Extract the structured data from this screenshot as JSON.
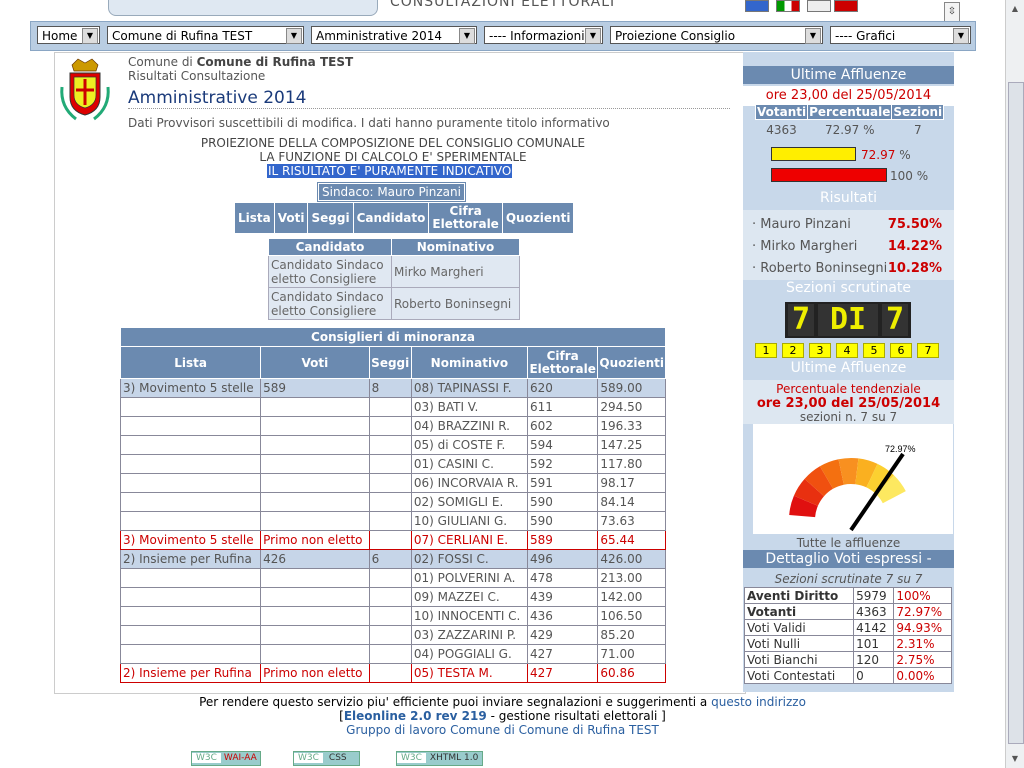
{
  "banner": {
    "title": "CONSULTAZIONI ELETTORALI"
  },
  "nav": {
    "selects": [
      "Home",
      "Comune di Rufina TEST",
      "Amministrative 2014",
      "---- Informazioni",
      "Proiezione Consiglio",
      "---- Grafici"
    ]
  },
  "header": {
    "comune_prefix": "Comune di",
    "comune_name": "Comune di Rufina TEST",
    "risultati": "Risultati Consultazione",
    "title": "Amministrative 2014",
    "notice": "Dati Provvisori suscettibili di modifica. I dati hanno puramente titolo informativo"
  },
  "projection": {
    "line1": "PROIEZIONE DELLA COMPOSIZIONE DEL CONSIGLIO COMUNALE",
    "line2": "LA FUNZIONE DI CALCOLO E' SPERIMENTALE",
    "line3": "IL RISULTATO E' PURAMENTE INDICATIVO",
    "sindaco": "Sindaco: Mauro Pinzani",
    "buttons": [
      "Lista",
      "Voti",
      "Seggi",
      "Candidato",
      "Cifra Elettorale",
      "Quozienti"
    ]
  },
  "candidates": {
    "headers": [
      "Candidato",
      "Nominativo"
    ],
    "rows": [
      {
        "role": "Candidato Sindaco eletto Consigliere",
        "name": "Mirko Margheri"
      },
      {
        "role": "Candidato Sindaco eletto Consigliere",
        "name": "Roberto Boninsegni"
      }
    ]
  },
  "minority": {
    "title": "Consiglieri di minoranza",
    "headers": [
      "Lista",
      "Voti",
      "Seggi",
      "Nominativo",
      "Cifra Elettorale",
      "Quozienti"
    ],
    "rows": [
      {
        "lista": "3) Movimento 5 stelle",
        "voti": "589",
        "seggi": "8",
        "nome": "08) TAPINASSI F.",
        "cifra": "620",
        "quoz": "589.00",
        "style": "hl-row"
      },
      {
        "lista": "",
        "voti": "",
        "seggi": "",
        "nome": "03) BATI V.",
        "cifra": "611",
        "quoz": "294.50",
        "style": ""
      },
      {
        "lista": "",
        "voti": "",
        "seggi": "",
        "nome": "04) BRAZZINI R.",
        "cifra": "602",
        "quoz": "196.33",
        "style": ""
      },
      {
        "lista": "",
        "voti": "",
        "seggi": "",
        "nome": "05) di COSTE F.",
        "cifra": "594",
        "quoz": "147.25",
        "style": ""
      },
      {
        "lista": "",
        "voti": "",
        "seggi": "",
        "nome": "01) CASINI C.",
        "cifra": "592",
        "quoz": "117.80",
        "style": ""
      },
      {
        "lista": "",
        "voti": "",
        "seggi": "",
        "nome": "06) INCORVAIA R.",
        "cifra": "591",
        "quoz": "98.17",
        "style": ""
      },
      {
        "lista": "",
        "voti": "",
        "seggi": "",
        "nome": "02) SOMIGLI E.",
        "cifra": "590",
        "quoz": "84.14",
        "style": ""
      },
      {
        "lista": "",
        "voti": "",
        "seggi": "",
        "nome": "10) GIULIANI G.",
        "cifra": "590",
        "quoz": "73.63",
        "style": ""
      },
      {
        "lista": "3) Movimento 5 stelle",
        "voti": "Primo non eletto",
        "seggi": "",
        "nome": "07) CERLIANI E.",
        "cifra": "589",
        "quoz": "65.44",
        "style": "red"
      },
      {
        "lista": "2) Insieme per Rufina",
        "voti": "426",
        "seggi": "6",
        "nome": "02) FOSSI C.",
        "cifra": "496",
        "quoz": "426.00",
        "style": "hl-row"
      },
      {
        "lista": "",
        "voti": "",
        "seggi": "",
        "nome": "01) POLVERINI A.",
        "cifra": "478",
        "quoz": "213.00",
        "style": ""
      },
      {
        "lista": "",
        "voti": "",
        "seggi": "",
        "nome": "09) MAZZEI C.",
        "cifra": "439",
        "quoz": "142.00",
        "style": ""
      },
      {
        "lista": "",
        "voti": "",
        "seggi": "",
        "nome": "10) INNOCENTI C.",
        "cifra": "436",
        "quoz": "106.50",
        "style": ""
      },
      {
        "lista": "",
        "voti": "",
        "seggi": "",
        "nome": "03) ZAZZARINI P.",
        "cifra": "429",
        "quoz": "85.20",
        "style": ""
      },
      {
        "lista": "",
        "voti": "",
        "seggi": "",
        "nome": "04) POGGIALI G.",
        "cifra": "427",
        "quoz": "71.00",
        "style": ""
      },
      {
        "lista": "2) Insieme per Rufina",
        "voti": "Primo non eletto",
        "seggi": "",
        "nome": "05) TESTA M.",
        "cifra": "427",
        "quoz": "60.86",
        "style": "red"
      }
    ]
  },
  "footer": {
    "line1_text": "Per rendere questo servizio piu' efficiente puoi inviare segnalazioni e suggerimenti a",
    "line1_link": "questo indirizzo",
    "line2_open": "[",
    "line2_link": "Eleonline 2.0 rev 219",
    "line2_text": "- gestione risultati elettorali ]",
    "line3": "Gruppo di lavoro Comune di Comune di Rufina TEST",
    "badges": [
      {
        "a": "W3C",
        "b": "WAI-AA"
      },
      {
        "a": "W3C",
        "b": "CSS"
      },
      {
        "a": "W3C",
        "b": "XHTML 1.0"
      }
    ]
  },
  "right": {
    "affluenze_title": "Ultime Affluenze",
    "affluenze_time": "ore 23,00 del 25/05/2014",
    "stats_headers": [
      "Votanti",
      "Percentuale",
      "Sezioni"
    ],
    "stats_values": [
      "4363",
      "72.97 %",
      "7"
    ],
    "bar1_label": "72.97",
    "bar1_unit": "%",
    "bar1_fraction": 0.7297,
    "bar2_label": "100 %",
    "risultati_title": "Risultati",
    "results": [
      {
        "name": "Mauro Pinzani",
        "pct": "75.50%"
      },
      {
        "name": "Mirko Margheri",
        "pct": "14.22%"
      },
      {
        "name": "Roberto Boninsegni",
        "pct": "10.28%"
      }
    ],
    "sezioni_title": "Sezioni scrutinate",
    "led_digits": [
      "7",
      "DI",
      "7"
    ],
    "sezioni": [
      "1",
      "2",
      "3",
      "4",
      "5",
      "6",
      "7"
    ],
    "affluenze_title2": "Ultime Affluenze",
    "tendenziale": "Percentuale tendenziale",
    "tend_time": "ore 23,00 del 25/05/2014",
    "sez_n": "sezioni n. 7 su 7",
    "gauge_label": "72.97%",
    "gauge_fraction": 0.7297,
    "tutte": "Tutte le affluenze",
    "dettaglio_title": "Dettaglio Voti espressi -",
    "scrutinate": "Sezioni scrutinate 7 su 7",
    "dettaglio": [
      {
        "label": "Aventi Diritto",
        "val": "5979",
        "pct": "100%",
        "bold": true
      },
      {
        "label": "Votanti",
        "val": "4363",
        "pct": "72.97%",
        "bold": true
      },
      {
        "label": "Voti Validi",
        "val": "4142",
        "pct": "94.93%",
        "bold": false
      },
      {
        "label": "Voti Nulli",
        "val": "101",
        "pct": "2.31%",
        "bold": false
      },
      {
        "label": "Voti Bianchi",
        "val": "120",
        "pct": "2.75%",
        "bold": false
      },
      {
        "label": "Voti Contestati",
        "val": "0",
        "pct": "0.00%",
        "bold": false
      }
    ]
  },
  "colors": {
    "accent": "#6b8ab0",
    "red": "#cc0000",
    "panel": "#c8d8ea",
    "highlight": "#c6d5e8"
  }
}
